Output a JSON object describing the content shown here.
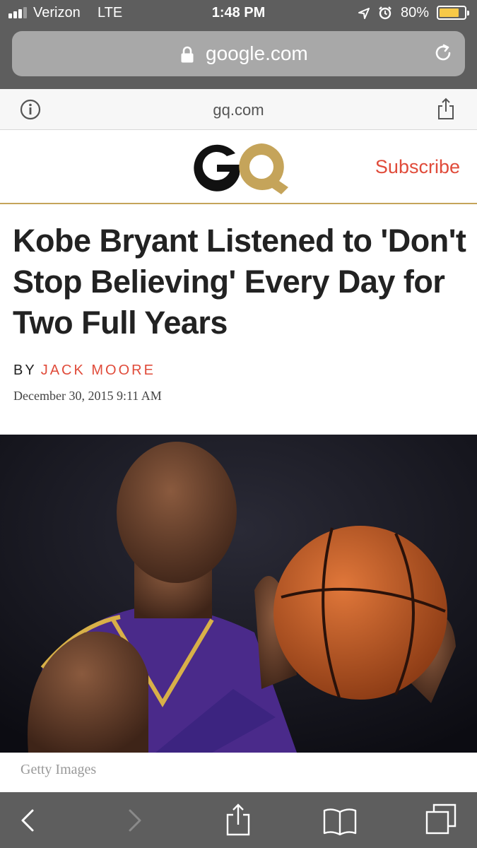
{
  "status_bar": {
    "carrier": "Verizon",
    "network": "LTE",
    "time": "1:48 PM",
    "battery_percent": "80%",
    "battery_level": 0.8,
    "icons": [
      "signal-icon",
      "location-icon",
      "alarm-icon",
      "battery-icon"
    ]
  },
  "browser": {
    "address": "google.com",
    "site_domain": "gq.com",
    "icons": [
      "lock-icon",
      "reload-icon",
      "info-icon",
      "share-icon"
    ]
  },
  "site_header": {
    "subscribe_label": "Subscribe",
    "colors": {
      "logo_g": "#111111",
      "logo_q": "#c5a45a",
      "accent": "#e04b3a"
    }
  },
  "article": {
    "headline": "Kobe Bryant Listened to 'Don't Stop Believing' Every Day for Two Full Years",
    "byline_prefix": "BY",
    "author": "JACK MOORE",
    "date": "December 30, 2015 9:11 AM",
    "image_credit": "Getty Images"
  },
  "toolbar": {
    "icons": [
      "back-icon",
      "forward-icon",
      "share-icon",
      "bookmarks-icon",
      "tabs-icon"
    ]
  }
}
